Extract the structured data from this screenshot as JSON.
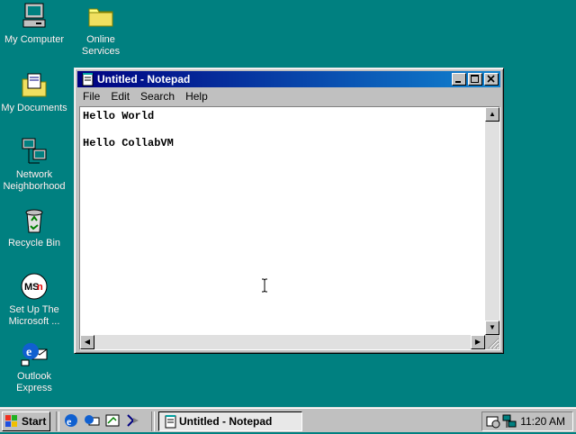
{
  "desktop": {
    "icons": [
      {
        "label": "My Computer",
        "icon": "my-computer-icon"
      },
      {
        "label": "Online Services",
        "icon": "folder-icon"
      },
      {
        "label": "My Documents",
        "icon": "my-documents-icon"
      },
      {
        "label": "Network Neighborhood",
        "icon": "network-icon"
      },
      {
        "label": "Recycle Bin",
        "icon": "recycle-bin-icon"
      },
      {
        "label": "Set Up The Microsoft ...",
        "icon": "msn-icon"
      },
      {
        "label": "Outlook Express",
        "icon": "outlook-express-icon"
      }
    ]
  },
  "window": {
    "title": "Untitled - Notepad",
    "menu": [
      "File",
      "Edit",
      "Search",
      "Help"
    ],
    "content": "Hello World\n\nHello CollabVM"
  },
  "taskbar": {
    "start_label": "Start",
    "task_label": "Untitled - Notepad",
    "clock": "11:20 AM"
  },
  "colors": {
    "desktop": "#008080",
    "titlebar": "#000080",
    "face": "#c0c0c0"
  }
}
